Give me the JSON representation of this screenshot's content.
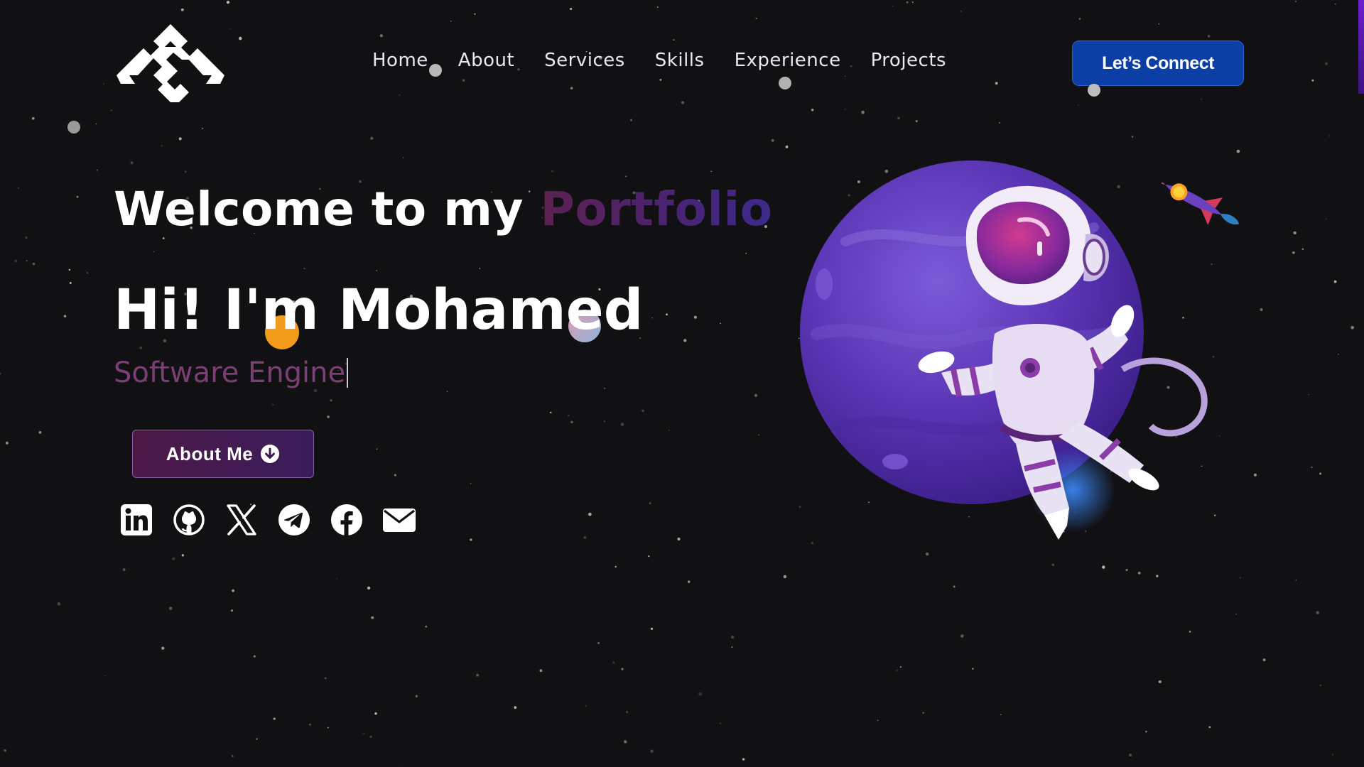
{
  "header": {
    "logo_icon": "site-logo-icon",
    "nav": [
      {
        "label": "Home"
      },
      {
        "label": "About"
      },
      {
        "label": "Services"
      },
      {
        "label": "Skills"
      },
      {
        "label": "Experience"
      },
      {
        "label": "Projects"
      }
    ],
    "cta_label": "Let’s Connect"
  },
  "hero": {
    "welcome_text": "Welcome to my ",
    "welcome_accent": "Portfolio",
    "greeting": "Hi! I'm Mohamed",
    "role_typed": "Software Engine",
    "about_button_label": "About Me",
    "about_button_icon": "arrow-down-circle-icon"
  },
  "socials": [
    {
      "name": "linkedin",
      "icon": "linkedin-icon"
    },
    {
      "name": "github",
      "icon": "github-icon"
    },
    {
      "name": "x",
      "icon": "x-icon"
    },
    {
      "name": "telegram",
      "icon": "telegram-icon"
    },
    {
      "name": "facebook",
      "icon": "facebook-icon"
    },
    {
      "name": "email",
      "icon": "mail-icon"
    }
  ],
  "illustration": {
    "subject": "astronaut-on-planet-illustration",
    "extra": "rocket-icon"
  },
  "colors": {
    "background": "#111012",
    "cta": "#0c3fa6",
    "accent_purple": "#4a2374",
    "role_text": "#7a3f74",
    "button_gradient_start": "#4d1a47"
  }
}
